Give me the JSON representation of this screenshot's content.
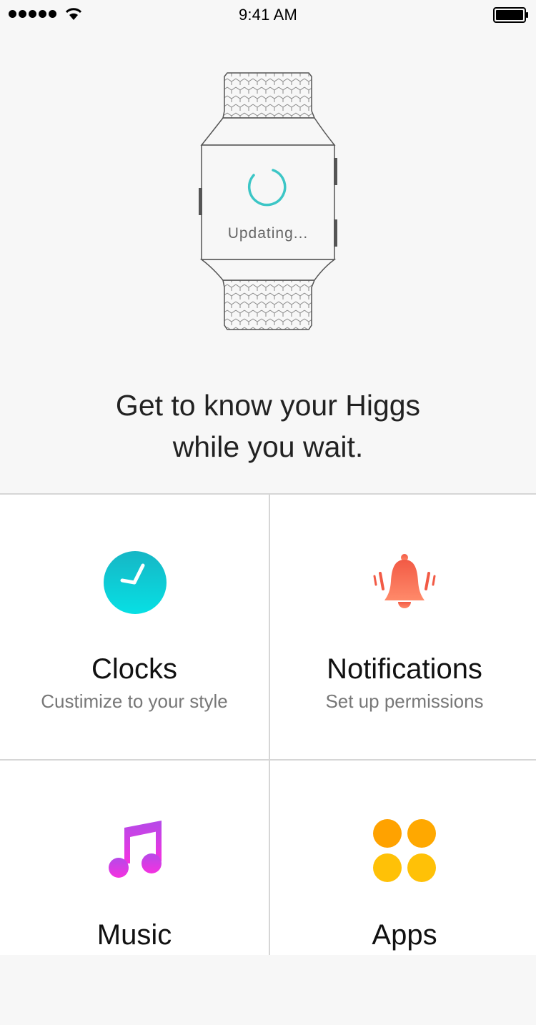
{
  "status_bar": {
    "time": "9:41 AM",
    "signal_icon": "signal-dots-icon",
    "wifi_icon": "wifi-icon",
    "battery_icon": "battery-full-icon"
  },
  "hero": {
    "device_icon": "smartwatch-icon",
    "spinner_icon": "loading-spinner-icon",
    "updating_label": "Updating...",
    "headline_line1": "Get to know your Higgs",
    "headline_line2": "while you wait."
  },
  "tiles": [
    {
      "title": "Clocks",
      "subtitle": "Custimize to your style",
      "icon": "clock-icon",
      "color": "#12c7d0"
    },
    {
      "title": "Notifications",
      "subtitle": "Set up permissions",
      "icon": "bell-icon",
      "color": "#f0604a"
    },
    {
      "title": "Music",
      "subtitle": "",
      "icon": "music-note-icon",
      "color": "#d63ce8"
    },
    {
      "title": "Apps",
      "subtitle": "",
      "icon": "apps-grid-icon",
      "color": "#ffb300"
    }
  ]
}
